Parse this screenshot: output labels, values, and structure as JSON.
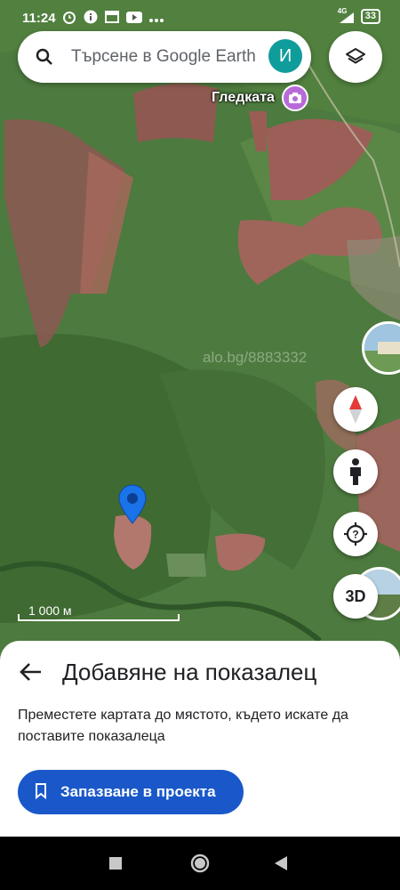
{
  "status_bar": {
    "time": "11:24",
    "network": "4G",
    "battery": "33"
  },
  "search": {
    "placeholder": "Търсене в Google Earth",
    "avatar_letter": "И"
  },
  "map": {
    "place_label": "Гледката",
    "watermark": "alo.bg/8883332",
    "scale_label": "1 000 м"
  },
  "controls": {
    "btn_3d": "3D"
  },
  "sheet": {
    "title": "Добавяне на показалец",
    "description": "Преместете картата до мястото, където искате да поставите показалеца",
    "save_label": "Запазване в проекта"
  },
  "colors": {
    "accent": "#1a58c9",
    "avatar": "#0f9d9c",
    "pin": "#1a73e8",
    "place_pin": "#b86ad9"
  },
  "icons": [
    "search-icon",
    "layers-icon",
    "camera-icon",
    "compass-icon",
    "pegman-icon",
    "my-location-icon",
    "back-arrow-icon",
    "bookmark-icon",
    "map-pin-icon"
  ]
}
